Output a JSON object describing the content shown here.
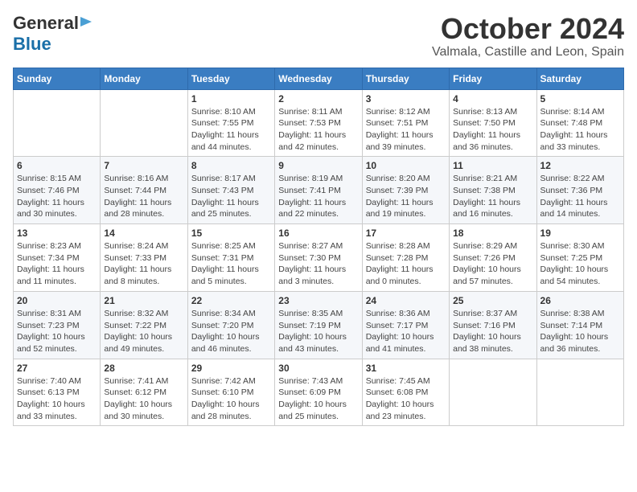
{
  "header": {
    "logo_general": "General",
    "logo_blue": "Blue",
    "title": "October 2024",
    "subtitle": "Valmala, Castille and Leon, Spain"
  },
  "calendar": {
    "days_of_week": [
      "Sunday",
      "Monday",
      "Tuesday",
      "Wednesday",
      "Thursday",
      "Friday",
      "Saturday"
    ],
    "weeks": [
      [
        {
          "day": "",
          "info": ""
        },
        {
          "day": "",
          "info": ""
        },
        {
          "day": "1",
          "info": "Sunrise: 8:10 AM\nSunset: 7:55 PM\nDaylight: 11 hours and 44 minutes."
        },
        {
          "day": "2",
          "info": "Sunrise: 8:11 AM\nSunset: 7:53 PM\nDaylight: 11 hours and 42 minutes."
        },
        {
          "day": "3",
          "info": "Sunrise: 8:12 AM\nSunset: 7:51 PM\nDaylight: 11 hours and 39 minutes."
        },
        {
          "day": "4",
          "info": "Sunrise: 8:13 AM\nSunset: 7:50 PM\nDaylight: 11 hours and 36 minutes."
        },
        {
          "day": "5",
          "info": "Sunrise: 8:14 AM\nSunset: 7:48 PM\nDaylight: 11 hours and 33 minutes."
        }
      ],
      [
        {
          "day": "6",
          "info": "Sunrise: 8:15 AM\nSunset: 7:46 PM\nDaylight: 11 hours and 30 minutes."
        },
        {
          "day": "7",
          "info": "Sunrise: 8:16 AM\nSunset: 7:44 PM\nDaylight: 11 hours and 28 minutes."
        },
        {
          "day": "8",
          "info": "Sunrise: 8:17 AM\nSunset: 7:43 PM\nDaylight: 11 hours and 25 minutes."
        },
        {
          "day": "9",
          "info": "Sunrise: 8:19 AM\nSunset: 7:41 PM\nDaylight: 11 hours and 22 minutes."
        },
        {
          "day": "10",
          "info": "Sunrise: 8:20 AM\nSunset: 7:39 PM\nDaylight: 11 hours and 19 minutes."
        },
        {
          "day": "11",
          "info": "Sunrise: 8:21 AM\nSunset: 7:38 PM\nDaylight: 11 hours and 16 minutes."
        },
        {
          "day": "12",
          "info": "Sunrise: 8:22 AM\nSunset: 7:36 PM\nDaylight: 11 hours and 14 minutes."
        }
      ],
      [
        {
          "day": "13",
          "info": "Sunrise: 8:23 AM\nSunset: 7:34 PM\nDaylight: 11 hours and 11 minutes."
        },
        {
          "day": "14",
          "info": "Sunrise: 8:24 AM\nSunset: 7:33 PM\nDaylight: 11 hours and 8 minutes."
        },
        {
          "day": "15",
          "info": "Sunrise: 8:25 AM\nSunset: 7:31 PM\nDaylight: 11 hours and 5 minutes."
        },
        {
          "day": "16",
          "info": "Sunrise: 8:27 AM\nSunset: 7:30 PM\nDaylight: 11 hours and 3 minutes."
        },
        {
          "day": "17",
          "info": "Sunrise: 8:28 AM\nSunset: 7:28 PM\nDaylight: 11 hours and 0 minutes."
        },
        {
          "day": "18",
          "info": "Sunrise: 8:29 AM\nSunset: 7:26 PM\nDaylight: 10 hours and 57 minutes."
        },
        {
          "day": "19",
          "info": "Sunrise: 8:30 AM\nSunset: 7:25 PM\nDaylight: 10 hours and 54 minutes."
        }
      ],
      [
        {
          "day": "20",
          "info": "Sunrise: 8:31 AM\nSunset: 7:23 PM\nDaylight: 10 hours and 52 minutes."
        },
        {
          "day": "21",
          "info": "Sunrise: 8:32 AM\nSunset: 7:22 PM\nDaylight: 10 hours and 49 minutes."
        },
        {
          "day": "22",
          "info": "Sunrise: 8:34 AM\nSunset: 7:20 PM\nDaylight: 10 hours and 46 minutes."
        },
        {
          "day": "23",
          "info": "Sunrise: 8:35 AM\nSunset: 7:19 PM\nDaylight: 10 hours and 43 minutes."
        },
        {
          "day": "24",
          "info": "Sunrise: 8:36 AM\nSunset: 7:17 PM\nDaylight: 10 hours and 41 minutes."
        },
        {
          "day": "25",
          "info": "Sunrise: 8:37 AM\nSunset: 7:16 PM\nDaylight: 10 hours and 38 minutes."
        },
        {
          "day": "26",
          "info": "Sunrise: 8:38 AM\nSunset: 7:14 PM\nDaylight: 10 hours and 36 minutes."
        }
      ],
      [
        {
          "day": "27",
          "info": "Sunrise: 7:40 AM\nSunset: 6:13 PM\nDaylight: 10 hours and 33 minutes."
        },
        {
          "day": "28",
          "info": "Sunrise: 7:41 AM\nSunset: 6:12 PM\nDaylight: 10 hours and 30 minutes."
        },
        {
          "day": "29",
          "info": "Sunrise: 7:42 AM\nSunset: 6:10 PM\nDaylight: 10 hours and 28 minutes."
        },
        {
          "day": "30",
          "info": "Sunrise: 7:43 AM\nSunset: 6:09 PM\nDaylight: 10 hours and 25 minutes."
        },
        {
          "day": "31",
          "info": "Sunrise: 7:45 AM\nSunset: 6:08 PM\nDaylight: 10 hours and 23 minutes."
        },
        {
          "day": "",
          "info": ""
        },
        {
          "day": "",
          "info": ""
        }
      ]
    ]
  }
}
